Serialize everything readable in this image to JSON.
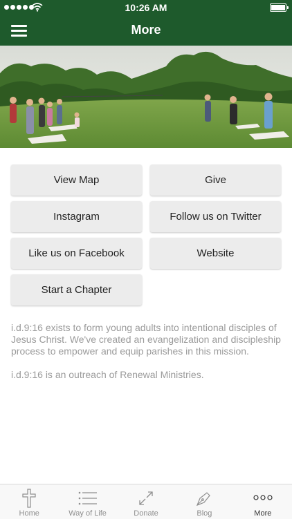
{
  "status_bar": {
    "time": "10:26 AM"
  },
  "header": {
    "title": "More"
  },
  "buttons": [
    {
      "label": "View Map"
    },
    {
      "label": "Give"
    },
    {
      "label": "Instagram"
    },
    {
      "label": "Follow us on Twitter"
    },
    {
      "label": "Like us on Facebook"
    },
    {
      "label": "Website"
    },
    {
      "label": "Start a Chapter"
    }
  ],
  "description": {
    "paragraph1": "i.d.9:16 exists to form young adults into intentional disciples of Jesus Christ. We've created an evangelization and discipleship process to empower and equip parishes in this mission.",
    "paragraph2": "i.d.9:16 is an outreach of Renewal Ministries."
  },
  "tabs": [
    {
      "label": "Home",
      "icon": "cross-icon"
    },
    {
      "label": "Way of Life",
      "icon": "list-icon"
    },
    {
      "label": "Donate",
      "icon": "arrows-icon"
    },
    {
      "label": "Blog",
      "icon": "pen-icon"
    },
    {
      "label": "More",
      "icon": "more-icon",
      "active": true
    }
  ],
  "colors": {
    "brand": "#1e5a2c",
    "button_bg": "#ececec",
    "text_muted": "#9a9a9a"
  }
}
